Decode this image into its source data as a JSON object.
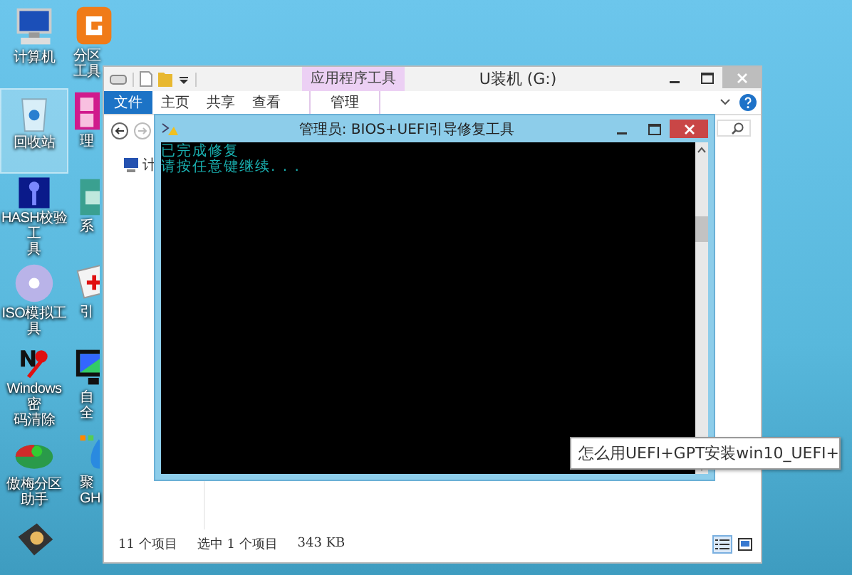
{
  "desktop": {
    "icons": [
      {
        "lines": [
          "计算机"
        ],
        "selected": false
      },
      {
        "lines": [
          "分区工具"
        ],
        "selected": false
      },
      {
        "lines": [
          "回收站"
        ],
        "selected": true
      },
      {
        "lines": [
          "理"
        ],
        "selected": false
      },
      {
        "lines": [
          "HASH校验工",
          "具"
        ],
        "selected": false
      },
      {
        "lines": [
          "系"
        ],
        "selected": false
      },
      {
        "lines": [
          "ISO模拟工具"
        ],
        "selected": false
      },
      {
        "lines": [
          "引"
        ],
        "selected": false
      },
      {
        "lines": [
          "Windows密",
          "码清除"
        ],
        "selected": false
      },
      {
        "lines": [
          "自",
          "全"
        ],
        "selected": false
      },
      {
        "lines": [
          "傲梅分区助手"
        ],
        "selected": false
      },
      {
        "lines": [
          "聚",
          "GH"
        ],
        "selected": false
      },
      {
        "selected": false
      }
    ]
  },
  "explorer": {
    "title": "U装机 (G:)",
    "context_tab": "应用程序工具",
    "ribbon_tabs": [
      {
        "label": "文件",
        "kind": "file"
      },
      {
        "label": "主页",
        "kind": "tab"
      },
      {
        "label": "共享",
        "kind": "tab"
      },
      {
        "label": "查看",
        "kind": "tab"
      },
      {
        "label": "管理",
        "kind": "context"
      }
    ],
    "nav_items": [
      {
        "label": "计"
      }
    ],
    "status_bar": [
      "11 个项目",
      "选中 1 个项目",
      "343 KB"
    ]
  },
  "console": {
    "title": "管理员: BIOS+UEFI引导修复工具",
    "lines": [
      "已完成修复",
      "请按任意键继续. . ."
    ]
  },
  "tooltip": {
    "text": "怎么用UEFI+GPT安装win10_UEFI+"
  }
}
